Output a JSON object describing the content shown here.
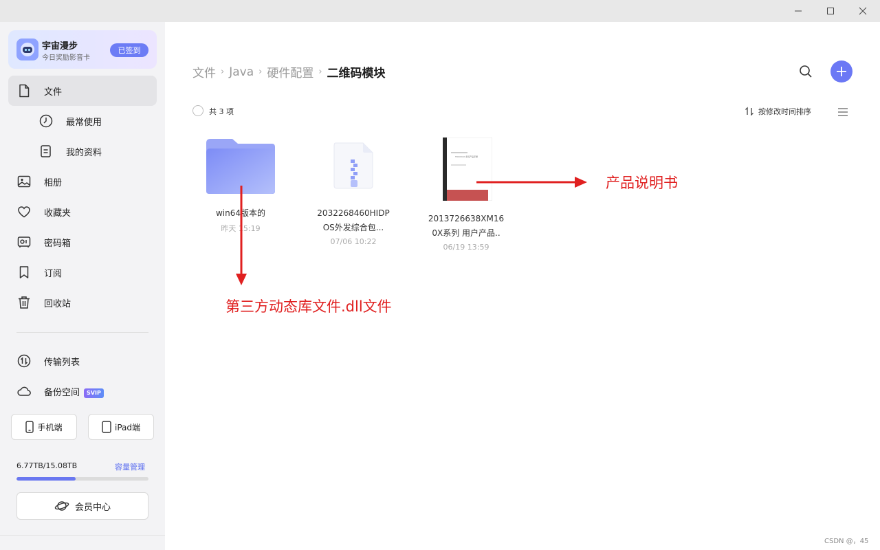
{
  "user": {
    "name": "宇宙漫步",
    "subtitle": "今日奖励影音卡",
    "sign_label": "已签到"
  },
  "sidebar": {
    "items": [
      {
        "label": "文件",
        "icon": "file-icon",
        "active": true
      },
      {
        "label": "最常使用",
        "icon": "clock-icon",
        "sub": true
      },
      {
        "label": "我的资料",
        "icon": "document-icon",
        "sub": true
      },
      {
        "label": "相册",
        "icon": "photo-icon"
      },
      {
        "label": "收藏夹",
        "icon": "heart-icon"
      },
      {
        "label": "密码箱",
        "icon": "safe-icon"
      },
      {
        "label": "订阅",
        "icon": "bookmark-icon"
      },
      {
        "label": "回收站",
        "icon": "trash-icon"
      }
    ],
    "transfer_label": "传输列表",
    "backup_label": "备份空间",
    "backup_badge": "SVIP",
    "phone_label": "手机端",
    "ipad_label": "iPad端",
    "storage_text": "6.77TB/15.08TB",
    "storage_manage": "容量管理",
    "storage_fraction": 0.449,
    "vip_label": "会员中心"
  },
  "breadcrumb": {
    "items": [
      "文件",
      "Java",
      "硬件配置"
    ],
    "current": "二维码模块"
  },
  "toolbar": {
    "count_label": "共 3 项",
    "sort_label": "按修改时间排序"
  },
  "files": [
    {
      "name_line1": "win64版本的",
      "name_line2": "",
      "date": "昨天 15:19",
      "type": "folder"
    },
    {
      "name_line1": "2032268460HIDP",
      "name_line2": "OS外发综合包...",
      "date": "07/06 10:22",
      "type": "zip"
    },
    {
      "name_line1": "2013726638XM16",
      "name_line2": "0X系列 用户产品..",
      "date": "06/19 13:59",
      "type": "pdf"
    }
  ],
  "annotations": {
    "product_manual": "产品说明书",
    "dll_note": "第三方动态库文件.dll文件"
  },
  "doc_thumb_text": "TRXXXXX 条码产品手册",
  "watermark": "CSDN @，45",
  "colors": {
    "accent": "#6b78f5",
    "annotation": "#e02020",
    "folder": "#8494f7"
  }
}
